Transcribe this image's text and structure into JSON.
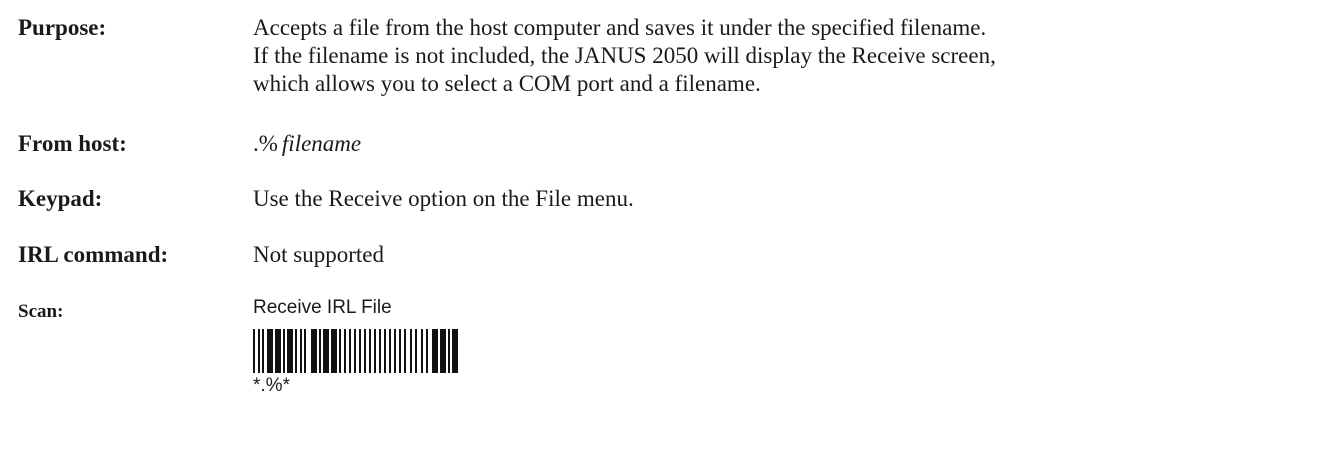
{
  "purpose": {
    "label": "Purpose:",
    "lines": [
      "Accepts a file from the host computer and saves it under the specified filename.",
      "If the filename is not included, the JANUS 2050 will display the Receive screen,",
      "which allows you to select a COM port and a filename."
    ]
  },
  "from_host": {
    "label": "From host:",
    "prefix": ".%",
    "argument": "filename"
  },
  "keypad": {
    "label": "Keypad:",
    "text": "Use the Receive option on the File menu."
  },
  "irl_command": {
    "label": "IRL command:",
    "text": "Not supported"
  },
  "scan": {
    "label": "Scan:",
    "barcode_title": "Receive IRL File",
    "barcode_text": "*.%*"
  }
}
